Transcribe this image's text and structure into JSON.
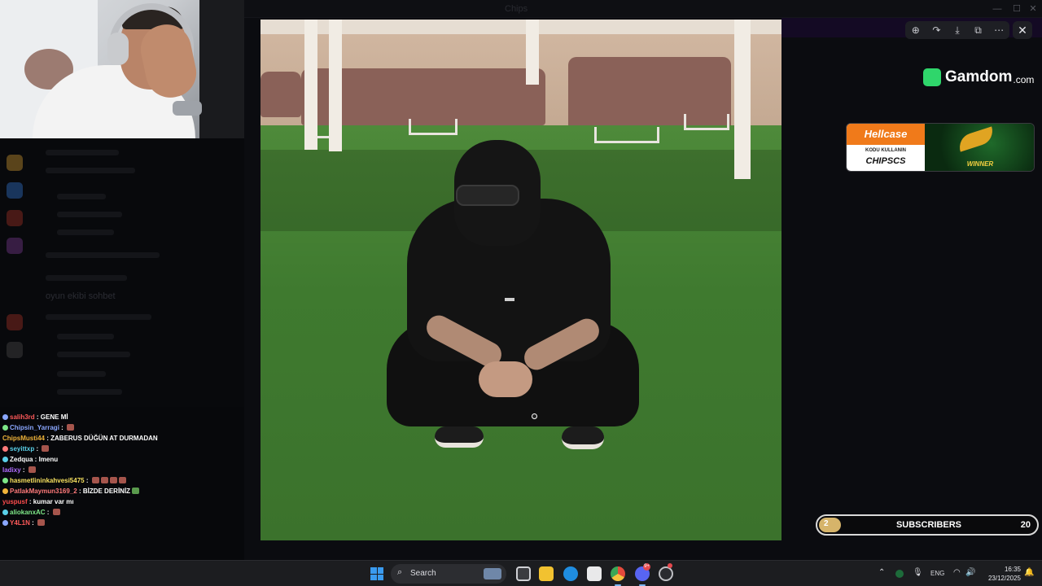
{
  "window": {
    "title": "Chips",
    "controls": {
      "minimize": "—",
      "maximize": "☐",
      "close": "✕"
    }
  },
  "viewer": {
    "toolbar": {
      "zoom_icon": "⊕",
      "share_icon": "↷",
      "download_icon": "⤓",
      "open_icon": "⧉",
      "more_icon": "⋯"
    },
    "close_icon": "✕"
  },
  "sidebar": {
    "channel_text": "oyun ekibi sohbet"
  },
  "chat": {
    "messages": [
      {
        "user": "salih3rd",
        "user_color": "#ff5a5a",
        "message": "GENE Mİ",
        "emotes": 0
      },
      {
        "user": "Chipsin_Yarragi",
        "user_color": "#8aa7ff",
        "message": "",
        "emotes": 1
      },
      {
        "user": "ChipsMusti44",
        "user_color": "#f0b43a",
        "message": "ZABERUS DÜĞÜN AT DURMADAN",
        "emotes": 0
      },
      {
        "user": "seyittxp",
        "user_color": "#5ad0e8",
        "message": "",
        "emotes": 1
      },
      {
        "user": "Zedqua",
        "user_color": "#ffffff",
        "message": "lmenu",
        "emotes": 0
      },
      {
        "user": "ladixy",
        "user_color": "#b06cff",
        "message": "",
        "emotes": 1
      },
      {
        "user": "hasmetlininkahvesi5475",
        "user_color": "#f6e05e",
        "message": "",
        "emotes": 4
      },
      {
        "user": "PatlakMaymun3169_2",
        "user_color": "#ff7a7a",
        "message": "BİZDE DERİNİZ",
        "emotes": 1,
        "emote_green": true
      },
      {
        "user": "yuspusf",
        "user_color": "#ff4d4d",
        "message": "kumar var mı",
        "emotes": 0
      },
      {
        "user": "aliokanxAC",
        "user_color": "#7ee787",
        "message": "",
        "emotes": 1
      },
      {
        "user": "Y4L1N",
        "user_color": "#ff5a5a",
        "message": "",
        "emotes": 1
      }
    ]
  },
  "sponsors": {
    "gamdom": {
      "name": "Gamdom",
      "tld": ".com"
    },
    "hellcase": {
      "brand": "Hellcase",
      "sub_text": "KODU KULLANIN",
      "code": "CHIPSCS",
      "badge": "WINNER"
    }
  },
  "subscribers_goal": {
    "label": "SUBSCRIBERS",
    "current": "2",
    "goal": "20",
    "progress_fraction": 0.1,
    "fill_color": "#d6b46a"
  },
  "taskbar": {
    "search_placeholder": "Search",
    "search_icon": "⌕",
    "tray": {
      "chevron": "⌃",
      "language": "ENG",
      "mic_icon": "🎙",
      "wifi_icon": "◠",
      "volume_icon": "🔊",
      "notifications_icon": "🔔"
    },
    "time": "16:35",
    "date": "23/12/2025",
    "discord_badge": "9+"
  }
}
